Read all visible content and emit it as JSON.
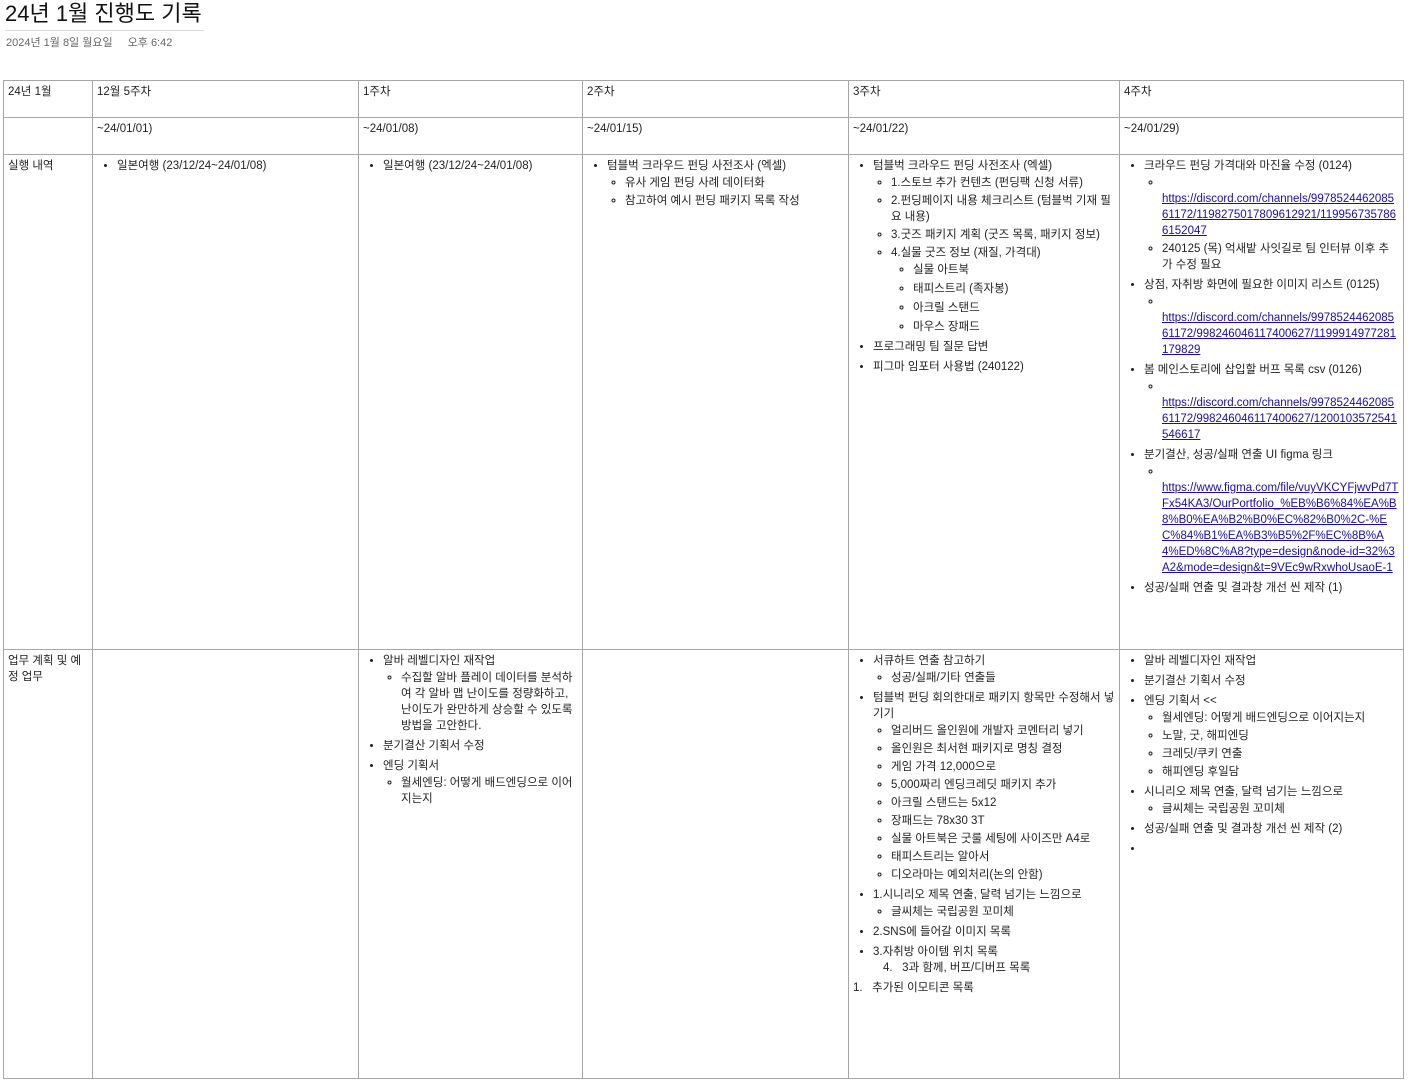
{
  "page": {
    "title": "24년 1월 진행도 기록",
    "date": "2024년 1월 8일 월요일",
    "time": "오후 6:42"
  },
  "table": {
    "header": [
      "24년 1월",
      "12월 5주차",
      "1주차",
      "2주차",
      "3주차",
      "4주차"
    ],
    "dates": [
      "",
      "~24/01/01)",
      "~24/01/08)",
      "~24/01/15)",
      "~24/01/22)",
      "~24/01/29)"
    ],
    "row_labels": {
      "exec": "실행 내역",
      "plan": "업무 계획 및 예정 업무"
    },
    "exec": {
      "dec5": [
        "일본여행 (23/12/24~24/01/08)"
      ],
      "w1": [
        "일본여행 (23/12/24~24/01/08)"
      ],
      "w2": {
        "item1": "텀블벅 크라우드 펀딩 사전조사 (엑셀)",
        "sub": [
          "유사 게임 펀딩 사례 데이터화",
          "참고하여 예시 펀딩 패키지 목록 작성"
        ]
      },
      "w3": {
        "item1": "텀블벅 크라우드 펀딩 사전조사 (엑셀)",
        "sub1": "1.스토브 추가 컨텐츠 (펀딩팩 신청 서류)",
        "sub2": "2.펀딩페이지 내용 체크리스트 (텀블벅 기재 필요 내용)",
        "sub3": "3.굿즈 패키지 계획 (굿즈 목록, 패키지 정보)",
        "sub4": "4.실물 굿즈 정보 (재질, 가격대)",
        "goods": [
          "실물 아트북",
          "태피스트리 (족자봉)",
          "아크릴 스탠드",
          "마우스 장패드"
        ],
        "item2": "프로그래밍 팀 질문 답변",
        "item3": "피그마 임포터 사용법 (240122)"
      },
      "w4": {
        "a": "크라우드 펀딩 가격대와 마진율 수정 (0124)",
        "a_link": "https://discord.com/channels/997852446208561172/1198275017809612921/1199567357866152047",
        "a_note": "240125 (목) 억새밭 사잇길로 팀 인터뷰 이후 추가 수정 필요",
        "b": "상점, 자취방 화면에 필요한 이미지 리스트 (0125)",
        "b_link": "https://discord.com/channels/997852446208561172/998246046117400627/1199914977281179829",
        "c": "봄 메인스토리에 삽입할 버프 목록 csv (0126)",
        "c_link": "https://discord.com/channels/997852446208561172/998246046117400627/1200103572541546617",
        "d": "분기결산, 성공/실패 연출 UI figma 링크",
        "d_link": "https://www.figma.com/file/vuyVKCYFjwvPd7TFx54KA3/OurPortfolio_%EB%B6%84%EA%B8%B0%EA%B2%B0%EC%82%B0%2C-%EC%84%B1%EA%B3%B5%2F%EC%8B%A4%ED%8C%A8?type=design&node-id=32%3A2&mode=design&t=9VEc9wRxwhoUsaoE-1",
        "e": "성공/실패 연출 및 결과창 개선 씬 제작 (1)"
      }
    },
    "plan": {
      "w1": {
        "a": "알바 레벨디자인 재작업",
        "a_sub": "수집할 알바 플레이 데이터를 분석하여 각 알바 맵 난이도를 정량화하고, 난이도가 완만하게 상승할 수 있도록 방법을 고안한다.",
        "b": "분기결산 기획서 수정",
        "c": "엔딩 기획서",
        "c_sub": "월세엔딩: 어떻게 배드엔딩으로 이어지는지"
      },
      "w3": {
        "a": "서큐하트 연출 참고하기",
        "a_sub": "성공/실패/기타 연출들",
        "b": "텀블벅 펀딩 회의한대로 패키지 항목만 수정해서 넣기기",
        "b_sub": [
          "얼리버드 올인원에 개발자 코멘터리 넣기",
          "올인원은 최서현 패키지로 명칭 결정",
          "게임 가격 12,000으로",
          "5,000짜리 엔딩크레딧 패키지 추가",
          "아크릴 스탠드는 5x12",
          "장패드는 78x30 3T",
          "실물 아트북은 굿룰 세팅에 사이즈만 A4로",
          "태피스트리는 알아서",
          "디오라마는 예외처리(논의 안함)"
        ],
        "c": "1.시니리오 제목 연출, 달력 넘기는 느낌으로",
        "c_sub": "글씨체는 국립공원 꼬미체",
        "d": "2.SNS에 들어갈 이미지 목록",
        "e": "3.자취방 아이템 위치 목록",
        "e_sub": "4.   3과 함께, 버프/디버프 목록",
        "f": "1.   추가된 이모티콘 목록"
      },
      "w4": {
        "a": "알바 레벨디자인 재작업",
        "b": "분기결산 기획서 수정",
        "c": "엔딩 기획서 <<",
        "c_sub": [
          "월세엔딩: 어떻게 배드엔딩으로 이어지는지",
          "노말, 굿, 해피엔딩",
          "크레딧/쿠키 연출",
          "해피엔딩 후일담"
        ],
        "d": "시니리오 제목 연출, 달력 넘기는 느낌으로",
        "d_sub": "글씨체는 국립공원 꼬미체",
        "e": "성공/실패 연출 및 결과창 개선 씬 제작 (2)"
      }
    }
  }
}
